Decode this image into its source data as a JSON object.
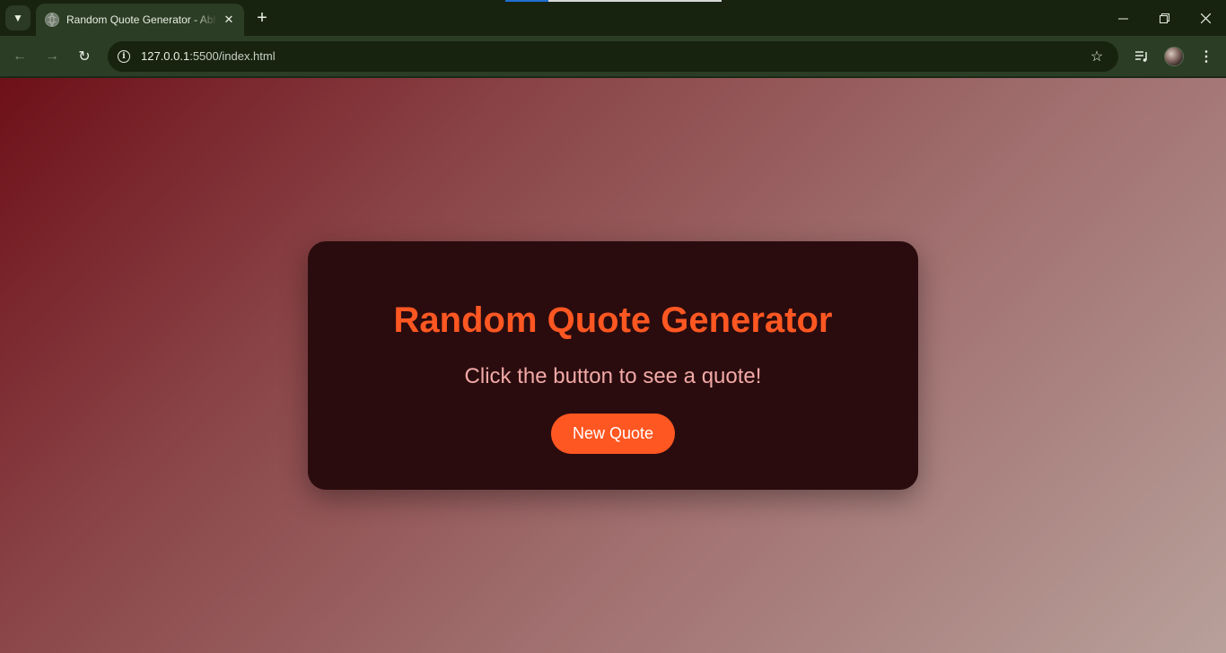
{
  "browser": {
    "tab_title": "Random Quote Generator - Abhishek",
    "url_host": "127.0.0.1",
    "url_path": ":5500/index.html"
  },
  "icons": {
    "tab_search": "chevron-down-icon",
    "favicon": "globe-icon",
    "tab_close": "close-icon",
    "new_tab": "plus-icon",
    "back": "arrow-left-icon",
    "forward": "arrow-right-icon",
    "reload": "reload-icon",
    "site_info": "info-icon",
    "bookmark": "star-icon",
    "media": "media-controls-icon",
    "menu": "kebab-menu-icon"
  },
  "page": {
    "title": "Random Quote Generator",
    "quote": "Click the button to see a quote!",
    "button_label": "New Quote"
  },
  "colors": {
    "accent": "#ff5722",
    "card_bg": "#2a0c0e",
    "quote_text": "#f2a9a6",
    "gradient_start": "#6e1018",
    "gradient_end": "#b8a09a"
  }
}
